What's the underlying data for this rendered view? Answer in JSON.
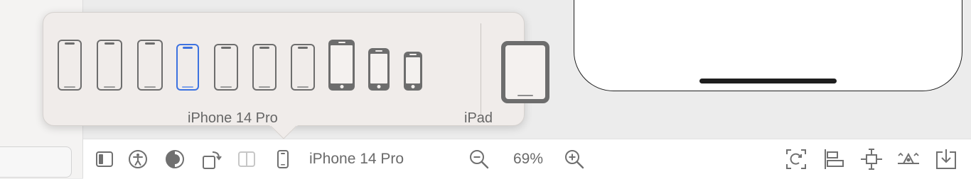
{
  "popover": {
    "iphone_label": "iPhone 14 Pro",
    "ipad_label": "iPad",
    "devices": [
      {
        "name": "device-option-1",
        "style": "notch",
        "selected": false
      },
      {
        "name": "device-option-2",
        "style": "notch",
        "selected": false
      },
      {
        "name": "device-option-3",
        "style": "notch",
        "selected": false
      },
      {
        "name": "device-option-iphone-14-pro",
        "style": "notch",
        "selected": true
      },
      {
        "name": "device-option-5",
        "style": "notch",
        "selected": false
      },
      {
        "name": "device-option-6",
        "style": "notch",
        "selected": false
      },
      {
        "name": "device-option-7",
        "style": "notch",
        "selected": false
      },
      {
        "name": "device-option-8",
        "style": "classic",
        "selected": false
      },
      {
        "name": "device-option-9",
        "style": "classic",
        "selected": false
      },
      {
        "name": "device-option-10",
        "style": "classic",
        "selected": false
      }
    ]
  },
  "toolbar": {
    "device_label": "iPhone 14 Pro",
    "zoom_label": "69%",
    "icons": [
      "sidebar-toggle-icon",
      "accessibility-icon",
      "appearance-icon",
      "rotate-icon",
      "split-view-icon",
      "device-icon",
      "zoom-out-icon",
      "zoom-in-icon",
      "update-frames-icon",
      "align-icon",
      "add-constraints-icon",
      "resolve-issues-icon",
      "embed-in-icon"
    ]
  },
  "colors": {
    "accent": "#3d72e0",
    "device_gray": "#6d6d6d",
    "popover_bg": "#f0ecea",
    "toolbar_bg": "#ffffff"
  }
}
